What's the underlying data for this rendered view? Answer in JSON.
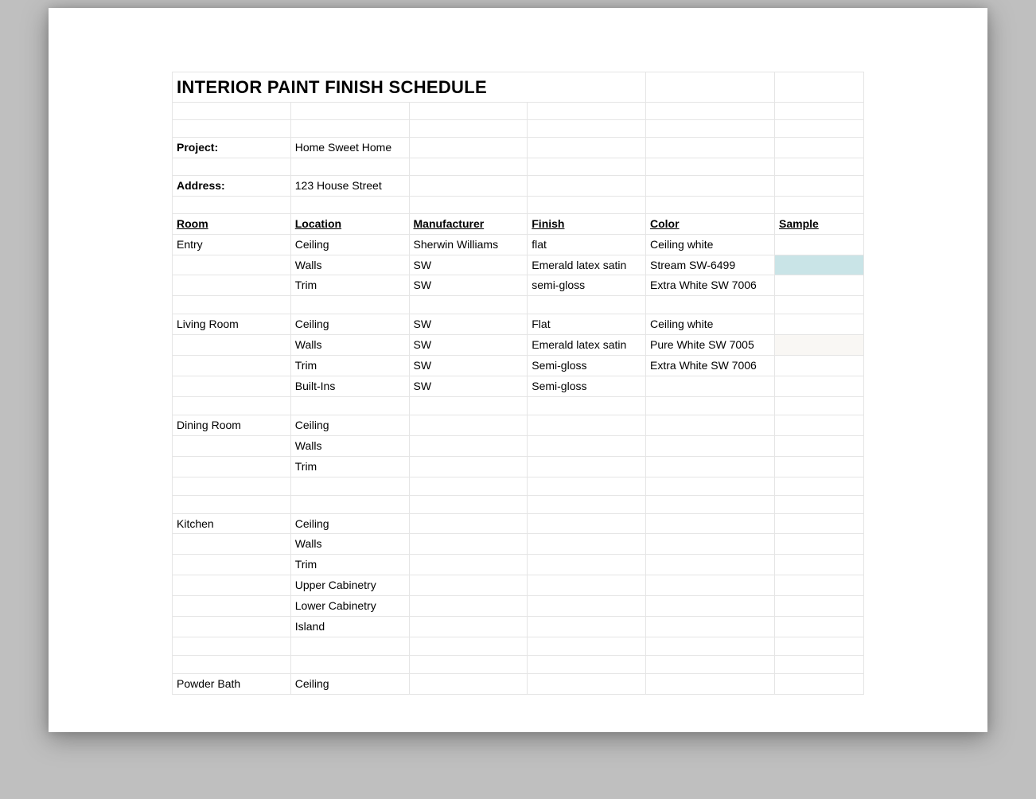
{
  "title": "INTERIOR PAINT FINISH SCHEDULE",
  "project_label": "Project:",
  "project_value": "Home Sweet Home",
  "address_label": "Address:",
  "address_value": "123 House Street",
  "headers": {
    "room": "Room",
    "location": "Location",
    "manufacturer": "Manufacturer",
    "finish": "Finish",
    "color": "Color",
    "sample": "Sample"
  },
  "rows": [
    {
      "room": "Entry",
      "location": "Ceiling",
      "manufacturer": "Sherwin Williams",
      "finish": "flat",
      "color": "Ceiling white",
      "sample_class": ""
    },
    {
      "room": "",
      "location": "Walls",
      "manufacturer": "SW",
      "finish": "Emerald latex satin",
      "color": "Stream SW-6499",
      "sample_class": "sample-stream"
    },
    {
      "room": "",
      "location": "Trim",
      "manufacturer": "SW",
      "finish": "semi-gloss",
      "color": "Extra White SW 7006",
      "sample_class": ""
    },
    {
      "room": "",
      "location": "",
      "manufacturer": "",
      "finish": "",
      "color": "",
      "sample_class": ""
    },
    {
      "room": "Living Room",
      "location": "Ceiling",
      "manufacturer": "SW",
      "finish": "Flat",
      "color": "Ceiling white",
      "sample_class": ""
    },
    {
      "room": "",
      "location": "Walls",
      "manufacturer": "SW",
      "finish": "Emerald latex satin",
      "color": "Pure White SW 7005",
      "sample_class": "sample-purewhite"
    },
    {
      "room": "",
      "location": "Trim",
      "manufacturer": "SW",
      "finish": "Semi-gloss",
      "color": "Extra White SW 7006",
      "sample_class": ""
    },
    {
      "room": "",
      "location": "Built-Ins",
      "manufacturer": "SW",
      "finish": "Semi-gloss",
      "color": "",
      "sample_class": ""
    },
    {
      "room": "",
      "location": "",
      "manufacturer": "",
      "finish": "",
      "color": "",
      "sample_class": ""
    },
    {
      "room": "Dining Room",
      "location": "Ceiling",
      "manufacturer": "",
      "finish": "",
      "color": "",
      "sample_class": ""
    },
    {
      "room": "",
      "location": "Walls",
      "manufacturer": "",
      "finish": "",
      "color": "",
      "sample_class": ""
    },
    {
      "room": "",
      "location": "Trim",
      "manufacturer": "",
      "finish": "",
      "color": "",
      "sample_class": ""
    },
    {
      "room": "",
      "location": "",
      "manufacturer": "",
      "finish": "",
      "color": "",
      "sample_class": ""
    },
    {
      "room": "",
      "location": "",
      "manufacturer": "",
      "finish": "",
      "color": "",
      "sample_class": ""
    },
    {
      "room": "Kitchen",
      "location": "Ceiling",
      "manufacturer": "",
      "finish": "",
      "color": "",
      "sample_class": ""
    },
    {
      "room": "",
      "location": "Walls",
      "manufacturer": "",
      "finish": "",
      "color": "",
      "sample_class": ""
    },
    {
      "room": "",
      "location": "Trim",
      "manufacturer": "",
      "finish": "",
      "color": "",
      "sample_class": ""
    },
    {
      "room": "",
      "location": "Upper Cabinetry",
      "manufacturer": "",
      "finish": "",
      "color": "",
      "sample_class": ""
    },
    {
      "room": "",
      "location": "Lower Cabinetry",
      "manufacturer": "",
      "finish": "",
      "color": "",
      "sample_class": ""
    },
    {
      "room": "",
      "location": "Island",
      "manufacturer": "",
      "finish": "",
      "color": "",
      "sample_class": ""
    },
    {
      "room": "",
      "location": "",
      "manufacturer": "",
      "finish": "",
      "color": "",
      "sample_class": ""
    },
    {
      "room": "",
      "location": "",
      "manufacturer": "",
      "finish": "",
      "color": "",
      "sample_class": ""
    },
    {
      "room": "Powder Bath",
      "location": "Ceiling",
      "manufacturer": "",
      "finish": "",
      "color": "",
      "sample_class": ""
    }
  ]
}
